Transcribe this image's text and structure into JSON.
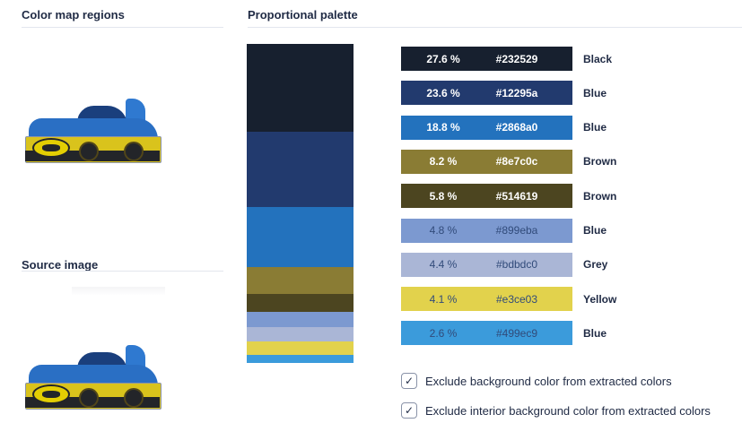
{
  "headers": {
    "color_map": "Color map regions",
    "palette": "Proportional palette",
    "source": "Source image"
  },
  "colors": [
    {
      "percent": "27.6 %",
      "hex": "#232529",
      "name": "Black",
      "swatch": "#17202f",
      "text": "dark",
      "weight": 27.6
    },
    {
      "percent": "23.6 %",
      "hex": "#12295a",
      "name": "Blue",
      "swatch": "#223a6e",
      "text": "dark",
      "weight": 23.6
    },
    {
      "percent": "18.8 %",
      "hex": "#2868a0",
      "name": "Blue",
      "swatch": "#2372bd",
      "text": "dark",
      "weight": 18.8
    },
    {
      "percent": "8.2 %",
      "hex": "#8e7c0c",
      "name": "Brown",
      "swatch": "#8a7c34",
      "text": "dark",
      "weight": 8.2
    },
    {
      "percent": "5.8 %",
      "hex": "#514619",
      "name": "Brown",
      "swatch": "#4c4520",
      "text": "dark",
      "weight": 5.8
    },
    {
      "percent": "4.8 %",
      "hex": "#899eba",
      "name": "Blue",
      "swatch": "#7c99d0",
      "text": "light",
      "weight": 4.8
    },
    {
      "percent": "4.4 %",
      "hex": "#bdbdc0",
      "name": "Grey",
      "swatch": "#aab6d6",
      "text": "light",
      "weight": 4.4
    },
    {
      "percent": "4.1 %",
      "hex": "#e3ce03",
      "name": "Yellow",
      "swatch": "#e2d24c",
      "text": "light",
      "weight": 4.1
    },
    {
      "percent": "2.6 %",
      "hex": "#499ec9",
      "name": "Blue",
      "swatch": "#3b9bdb",
      "text": "light",
      "weight": 2.6
    }
  ],
  "options": {
    "exclude_bg": {
      "label": "Exclude background color from extracted colors",
      "checked": true
    },
    "exclude_interior": {
      "label": "Exclude interior background color from extracted colors",
      "checked": true
    }
  },
  "check_glyph": "✓",
  "icons": {
    "thumbnail": "toy-car-image",
    "check": "check-icon"
  }
}
